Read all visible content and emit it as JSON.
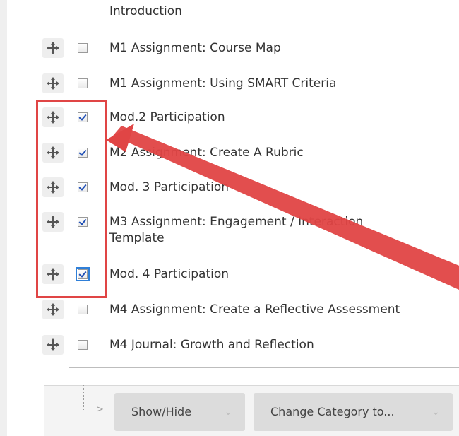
{
  "items": [
    {
      "label": "M1 Assignment: Course Map",
      "checked": false
    },
    {
      "label": "M1 Assignment: Using SMART Criteria",
      "checked": false
    },
    {
      "label": "Mod.2 Participation",
      "checked": true
    },
    {
      "label": "M2 Assignment: Create A Rubric",
      "checked": true
    },
    {
      "label": "Mod. 3 Participation",
      "checked": true
    },
    {
      "label": "M3 Assignment: Engagement / Interaction",
      "label_line2": "Template",
      "checked": true
    },
    {
      "label": "Mod. 4 Participation",
      "checked": true,
      "focused": true
    },
    {
      "label": "M4 Assignment: Create a Reflective Assessment",
      "checked": false
    },
    {
      "label": "M4 Journal: Growth and Reflection",
      "checked": false
    }
  ],
  "intro_label": "Introduction",
  "footer": {
    "show_hide_label": "Show/Hide",
    "change_category_label": "Change Category to..."
  },
  "annotation": {
    "color": "#e04545"
  },
  "icons": {
    "drag": "move-arrows-icon",
    "chevron": "double-chevron-down-icon"
  }
}
